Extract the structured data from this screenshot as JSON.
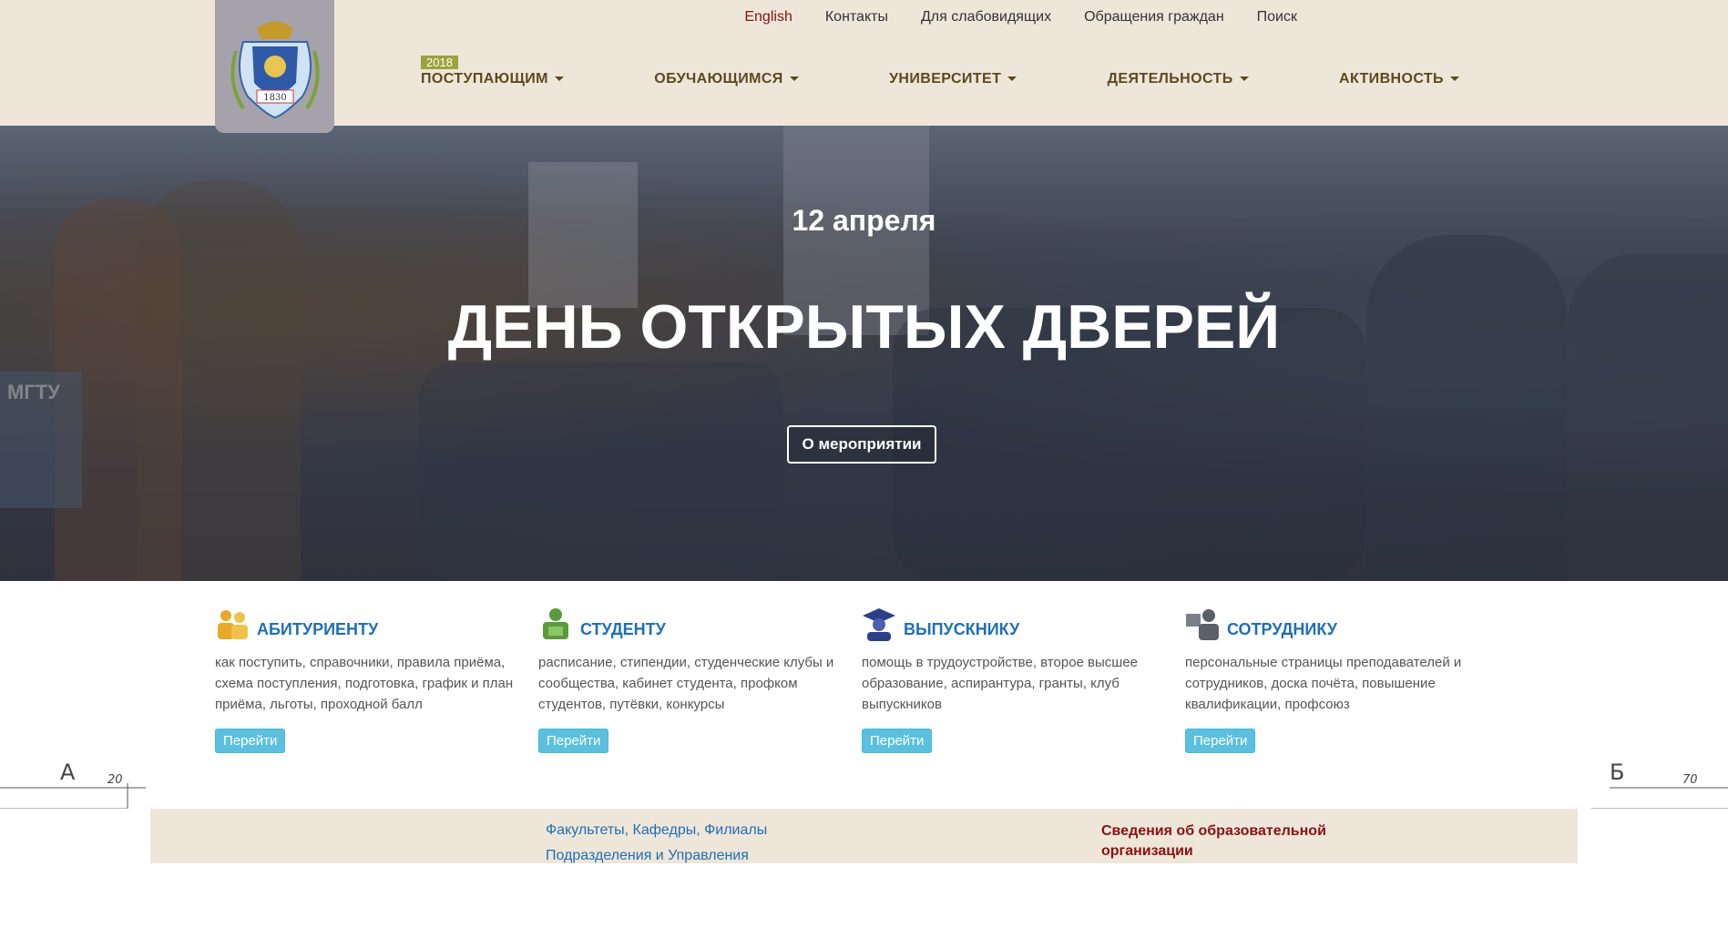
{
  "header": {
    "top_links": [
      "English",
      "Контакты",
      "Для слабовидящих",
      "Обращения граждан",
      "Поиск"
    ],
    "year_badge": "2018",
    "nav": [
      "ПОСТУПАЮЩИМ",
      "ОБУЧАЮЩИМСЯ",
      "УНИВЕРСИТЕТ",
      "ДЕЯТЕЛЬНОСТЬ",
      "АКТИВНОСТЬ"
    ],
    "logo_year": "1830"
  },
  "hero": {
    "date": "12 апреля",
    "title": "ДЕНЬ ОТКРЫТЫХ ДВЕРЕЙ",
    "button": "О мероприятии",
    "photo_book_text": "МГТУ"
  },
  "cards": [
    {
      "title": "АБИТУРИЕНТУ",
      "text": "как поступить, справочники, правила приёма, схема поступления, подготовка, график и план приёма, льготы, проходной балл",
      "button": "Перейти",
      "icon": "applicants-icon"
    },
    {
      "title": "СТУДЕНТУ",
      "text": "расписание, стипендии, студенческие клубы и сообщества, кабинет студента, профком студентов, путёвки, конкурсы",
      "button": "Перейти",
      "icon": "student-icon"
    },
    {
      "title": "ВЫПУСКНИКУ",
      "text": "помощь в трудоустройстве, второе высшее образование, аспирантура, гранты, клуб выпускников",
      "button": "Перейти",
      "icon": "graduate-icon"
    },
    {
      "title": "СОТРУДНИКУ",
      "text": "персональные страницы преподавателей и сотрудников, доска почёта, повышение квалификации, профсоюз",
      "button": "Перейти",
      "icon": "staff-icon"
    }
  ],
  "footer": {
    "links": [
      "Факультеты, Кафедры, Филиалы",
      "Подразделения и Управления"
    ],
    "org_info": "Сведения об образовательной организации",
    "drawing_labels": [
      "А",
      "20",
      "Б",
      "70"
    ]
  },
  "colors": {
    "header_bg": "#efe6da",
    "nav_text": "#5b4a1e",
    "link_blue": "#1f6fb4",
    "accent_red": "#8b1010",
    "button_cyan": "#5bc0de",
    "badge_olive": "#9ea23e"
  }
}
